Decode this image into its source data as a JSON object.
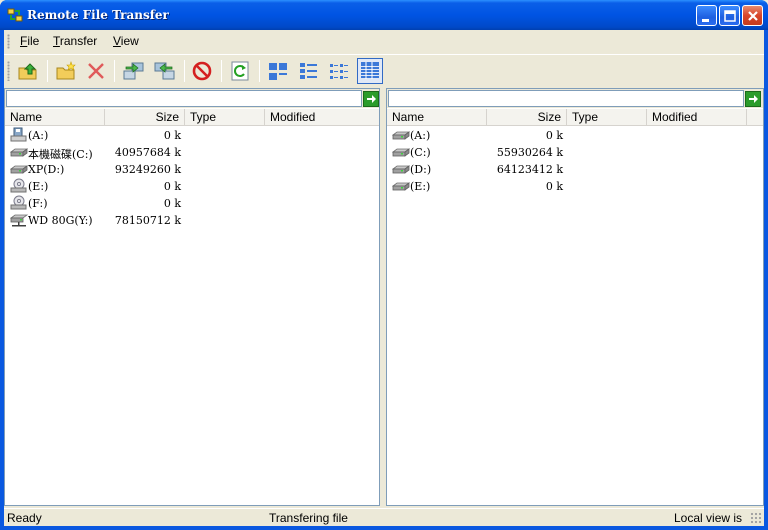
{
  "window": {
    "title": "Remote File Transfer"
  },
  "menu": [
    "File",
    "Transfer",
    "View"
  ],
  "toolbar": [
    {
      "name": "up-folder-icon"
    },
    {
      "name": "new-folder-icon"
    },
    {
      "name": "delete-icon"
    },
    {
      "name": "upload-icon"
    },
    {
      "name": "download-icon"
    },
    {
      "name": "stop-icon"
    },
    {
      "name": "refresh-icon"
    },
    {
      "name": "large-icons-view-icon"
    },
    {
      "name": "small-icons-view-icon"
    },
    {
      "name": "list-view-icon"
    },
    {
      "name": "details-view-icon"
    }
  ],
  "columns": {
    "name": "Name",
    "size": "Size",
    "type": "Type",
    "modified": "Modified"
  },
  "left": {
    "path": "",
    "items": [
      {
        "icon": "floppy-drive-icon",
        "name": "(A:)",
        "size": "0 k"
      },
      {
        "icon": "hard-drive-icon",
        "name": "本機磁碟(C:)",
        "size": "40957684 k"
      },
      {
        "icon": "hard-drive-icon",
        "name": "XP(D:)",
        "size": "93249260 k"
      },
      {
        "icon": "cd-drive-icon",
        "name": "(E:)",
        "size": "0 k"
      },
      {
        "icon": "cd-drive-icon",
        "name": "(F:)",
        "size": "0 k"
      },
      {
        "icon": "network-drive-icon",
        "name": "WD 80G(Y:)",
        "size": "78150712 k"
      }
    ]
  },
  "right": {
    "path": "",
    "items": [
      {
        "icon": "hard-drive-icon",
        "name": "(A:)",
        "size": "0 k"
      },
      {
        "icon": "hard-drive-icon",
        "name": "(C:)",
        "size": "55930264 k"
      },
      {
        "icon": "hard-drive-icon",
        "name": "(D:)",
        "size": "64123412 k"
      },
      {
        "icon": "hard-drive-icon",
        "name": "(E:)",
        "size": "0 k"
      }
    ]
  },
  "status": {
    "left": "Ready",
    "center": "Transfering file",
    "right": "Local view is"
  }
}
